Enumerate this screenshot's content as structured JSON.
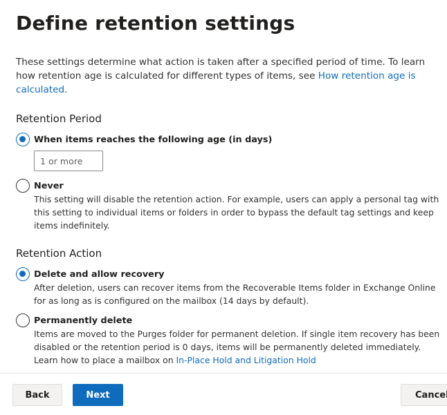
{
  "page": {
    "title": "Define retention settings",
    "intro_text": "These settings determine what action is taken after a specified period of time. To learn how retention age is calculated for different types of items, see ",
    "intro_link": "How retention age is calculated",
    "intro_end": "."
  },
  "retention_period": {
    "heading": "Retention Period",
    "options": [
      {
        "label": "When items reaches the following age (in days)",
        "checked": true
      },
      {
        "label": "Never",
        "description": "This setting will disable the retention action. For example, users can apply a personal tag with this setting to individual items or folders in order to bypass the default tag settings and keep items indefinitely.",
        "checked": false
      }
    ],
    "age_input": {
      "value": "",
      "placeholder": "1 or more"
    }
  },
  "retention_action": {
    "heading": "Retention Action",
    "options": [
      {
        "label": "Delete and allow recovery",
        "description": "After deletion, users can recover items from the Recoverable Items folder in Exchange Online for as long as is configured on the mailbox (14 days by default).",
        "checked": true
      },
      {
        "label": "Permanently delete",
        "description": "Items are moved to the Purges folder for permanent deletion. If single item recovery has been disabled or the retention period is 0 days, items will be permanently deleted immediately. Learn how to place a mailbox on ",
        "description_link": "In-Place Hold and Litigation Hold",
        "checked": false
      }
    ]
  },
  "footer": {
    "back_label": "Back",
    "next_label": "Next",
    "cancel_label": "Cancel"
  },
  "colors": {
    "accent": "#0f6cbd",
    "text": "#323130",
    "divider": "#e1dfdd"
  }
}
